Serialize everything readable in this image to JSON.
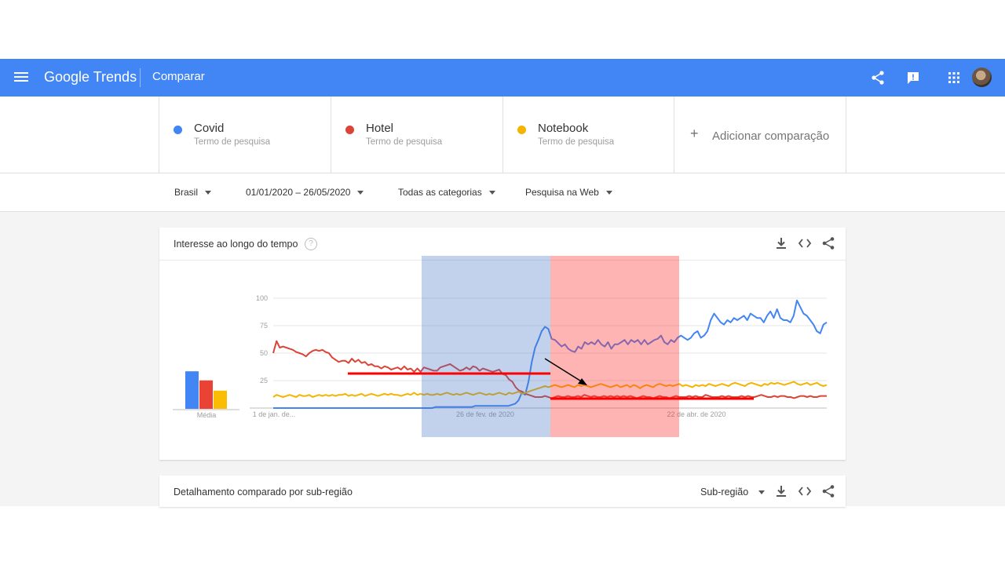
{
  "header": {
    "logo": "Google Trends",
    "title": "Comparar"
  },
  "terms": [
    {
      "name": "Covid",
      "sub": "Termo de pesquisa",
      "color": "#4285f4"
    },
    {
      "name": "Hotel",
      "sub": "Termo de pesquisa",
      "color": "#db4437"
    },
    {
      "name": "Notebook",
      "sub": "Termo de pesquisa",
      "color": "#f4b400"
    }
  ],
  "add_comparison": {
    "icon": "plus-icon",
    "label": "Adicionar comparação"
  },
  "filters": {
    "region": "Brasil",
    "date_range": "01/01/2020 – 26/05/2020",
    "category": "Todas as categorias",
    "search_type": "Pesquisa na Web"
  },
  "interest_card": {
    "title": "Interesse ao longo do tempo",
    "help_icon": "?",
    "actions": [
      "download-icon",
      "embed-icon",
      "share-icon"
    ],
    "average_label": "Média"
  },
  "subregion_card": {
    "title": "Detalhamento comparado por sub-região",
    "dropdown": "Sub-região"
  },
  "chart_data": {
    "type": "line",
    "yticks": [
      "100",
      "75",
      "50",
      "25"
    ],
    "ylim": [
      0,
      100
    ],
    "xticks": [
      "1 de jan. de...",
      "26 de fev. de 2020",
      "22 de abr. de 2020"
    ],
    "grid": true,
    "average_bars": [
      {
        "name": "Covid",
        "value": 33,
        "color": "#4285f4"
      },
      {
        "name": "Hotel",
        "value": 25,
        "color": "#ea4335"
      },
      {
        "name": "Notebook",
        "value": 16,
        "color": "#fbbc04"
      }
    ],
    "series": [
      {
        "name": "Covid",
        "color": "#4285f4",
        "values": [
          0,
          0,
          0,
          0,
          0,
          0,
          0,
          0,
          0,
          0,
          0,
          0,
          0,
          0,
          0,
          0,
          0,
          0,
          0,
          0,
          0,
          0,
          0,
          0,
          0,
          0,
          0,
          0,
          0,
          0,
          0,
          0,
          0,
          0,
          0,
          0,
          0,
          0,
          0,
          0,
          0,
          0,
          0,
          0,
          0,
          0,
          0,
          0,
          0,
          1,
          1,
          1,
          1,
          1,
          1,
          1,
          1,
          1,
          1,
          1,
          1,
          2,
          2,
          2,
          2,
          2,
          2,
          2,
          2,
          2,
          2,
          2,
          3,
          4,
          7,
          14,
          12,
          24,
          42,
          55,
          62,
          70,
          74,
          72,
          63,
          62,
          59,
          56,
          58,
          54,
          52,
          51,
          56,
          54,
          60,
          58,
          60,
          58,
          62,
          58,
          56,
          60,
          54,
          58,
          58,
          60,
          62,
          58,
          62,
          60,
          62,
          58,
          62,
          58,
          60,
          62,
          63,
          66,
          60,
          58,
          62,
          60,
          64,
          66,
          64,
          62,
          64,
          68,
          70,
          64,
          66,
          70,
          80,
          86,
          82,
          78,
          76,
          80,
          78,
          82,
          80,
          82,
          84,
          80,
          86,
          84,
          82,
          82,
          78,
          84,
          88,
          82,
          90,
          82,
          80,
          80,
          78,
          84,
          98,
          92,
          86,
          84,
          80,
          76,
          70,
          68,
          76,
          78
        ]
      },
      {
        "name": "Hotel",
        "color": "#db4437",
        "values": [
          50,
          61,
          55,
          56,
          55,
          54,
          53,
          51,
          50,
          49,
          47,
          50,
          52,
          53,
          52,
          53,
          51,
          50,
          46,
          44,
          42,
          43,
          43,
          41,
          45,
          42,
          44,
          41,
          42,
          39,
          40,
          38,
          38,
          36,
          38,
          37,
          35,
          36,
          37,
          35,
          38,
          35,
          36,
          33,
          36,
          33,
          37,
          36,
          35,
          34,
          34,
          37,
          38,
          39,
          40,
          38,
          36,
          34,
          35,
          37,
          35,
          38,
          37,
          34,
          36,
          35,
          34,
          33,
          34,
          35,
          31,
          30,
          26,
          24,
          19,
          16,
          15,
          13,
          12,
          11,
          10,
          10,
          10,
          11,
          10,
          9,
          10,
          11,
          10,
          10,
          11,
          10,
          10,
          11,
          10,
          12,
          11,
          10,
          11,
          10,
          10,
          11,
          10,
          11,
          10,
          11,
          10,
          11,
          10,
          11,
          10,
          9,
          10,
          11,
          10,
          10,
          9,
          10,
          11,
          10,
          10,
          9,
          10,
          11,
          10,
          10,
          10,
          11,
          10,
          11,
          10,
          10,
          12,
          11,
          10,
          10,
          10,
          11,
          10,
          11,
          10,
          10,
          10,
          11,
          10,
          11,
          10,
          10,
          11,
          12,
          11,
          10,
          10,
          11,
          10,
          11,
          11,
          10,
          10,
          9,
          10,
          11,
          11,
          10,
          11,
          10,
          10,
          11,
          11,
          11
        ]
      },
      {
        "name": "Notebook",
        "color": "#f4b400",
        "values": [
          10,
          12,
          11,
          10,
          11,
          12,
          11,
          10,
          12,
          11,
          11,
          12,
          10,
          11,
          12,
          11,
          12,
          11,
          12,
          11,
          12,
          12,
          13,
          11,
          12,
          11,
          12,
          13,
          11,
          12,
          13,
          12,
          11,
          12,
          13,
          12,
          13,
          12,
          12,
          11,
          12,
          13,
          12,
          14,
          12,
          13,
          12,
          13,
          12,
          12,
          13,
          12,
          13,
          14,
          13,
          12,
          13,
          12,
          13,
          14,
          13,
          12,
          13,
          14,
          13,
          12,
          13,
          12,
          13,
          14,
          13,
          12,
          14,
          13,
          14,
          15,
          13,
          14,
          15,
          16,
          17,
          18,
          19,
          20,
          19,
          20,
          21,
          20,
          19,
          20,
          21,
          20,
          19,
          21,
          20,
          21,
          20,
          19,
          20,
          21,
          22,
          21,
          20,
          19,
          20,
          21,
          19,
          20,
          21,
          19,
          21,
          20,
          18,
          20,
          21,
          20,
          19,
          21,
          22,
          21,
          20,
          21,
          20,
          21,
          22,
          20,
          21,
          20,
          19,
          21,
          20,
          21,
          20,
          22,
          21,
          20,
          21,
          22,
          21,
          20,
          22,
          23,
          22,
          21,
          20,
          22,
          23,
          22,
          21,
          20,
          22,
          21,
          23,
          22,
          23,
          22,
          21,
          22,
          23,
          24,
          22,
          21,
          22,
          23,
          21,
          22,
          23,
          21,
          20,
          21
        ]
      }
    ],
    "annotations": [
      "highlight-blue-region",
      "highlight-red-region",
      "red-level-line-before",
      "red-level-line-after",
      "arrow"
    ]
  }
}
